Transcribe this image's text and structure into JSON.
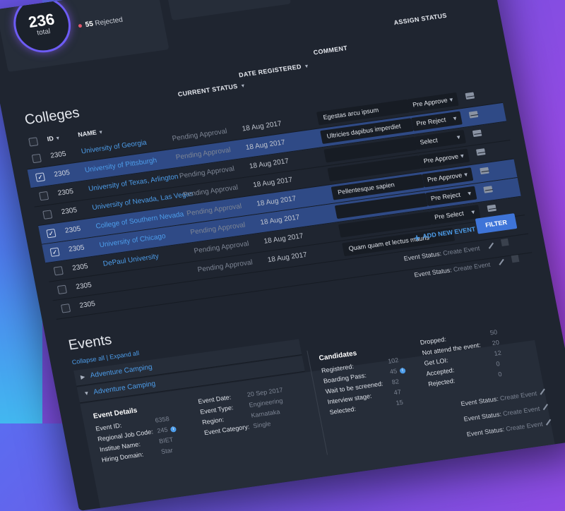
{
  "summary": {
    "total_number": "236",
    "total_label": "total",
    "rejected_count": "55",
    "rejected_label": "Rejected"
  },
  "colleges": {
    "title": "Colleges",
    "headers": {
      "id": "ID",
      "name": "NAME",
      "current_status": "CURRENT STATUS",
      "date_registered": "DATE REGISTERED",
      "comment": "COMMENT",
      "assign_status": "ASSIGN STATUS"
    },
    "rows": [
      {
        "id": "2305",
        "name": "University of Georgia",
        "status": "Pending Approval",
        "date": "18 Aug 2017",
        "comment": "Egestas arcu ipsum",
        "assign": "Pre Approve",
        "selected": false
      },
      {
        "id": "2305",
        "name": "University of Pittsburgh",
        "status": "Pending Approval",
        "date": "18 Aug 2017",
        "comment": "Ultricies dapibus imperdiet",
        "assign": "Pre Reject",
        "selected": true
      },
      {
        "id": "2305",
        "name": "University of Texas, Arlington",
        "status": "Pending Approval",
        "date": "18 Aug 2017",
        "comment": "",
        "assign": "Select",
        "selected": false
      },
      {
        "id": "2305",
        "name": "University of Nevada, Las Vegas",
        "status": "Pending Approval",
        "date": "18 Aug 2017",
        "comment": "",
        "assign": "Pre Approve",
        "selected": false
      },
      {
        "id": "2305",
        "name": "College of Southern Nevada",
        "status": "Pending Approval",
        "date": "18 Aug 2017",
        "comment": "Pellentesque sapien",
        "assign": "Pre Approve",
        "selected": true
      },
      {
        "id": "2305",
        "name": "University of Chicago",
        "status": "Pending Approval",
        "date": "18 Aug 2017",
        "comment": "",
        "assign": "Pre Reject",
        "selected": true
      },
      {
        "id": "2305",
        "name": "DePaul University",
        "status": "Pending Approval",
        "date": "18 Aug 2017",
        "comment": "",
        "assign": "Pre Select",
        "selected": false
      },
      {
        "id": "2305",
        "name": "",
        "status": "Pending Approval",
        "date": "18 Aug 2017",
        "comment": "Quam quam et lectus mauris",
        "assign": "",
        "selected": false
      },
      {
        "id": "2305",
        "name": "",
        "status": "",
        "date": "",
        "comment": "",
        "assign": "",
        "selected": false
      }
    ],
    "add_event_label": "ADD NEW EVENT",
    "filter_label": "FILTER"
  },
  "event_status": {
    "label": "Event Status:",
    "value": "Create Event"
  },
  "events": {
    "title": "Events",
    "collapse_all": "Collapse all",
    "separator": "|",
    "expand_all": "Expand all",
    "items": [
      {
        "name": "Adventure Camping",
        "expanded": false
      },
      {
        "name": "Adventure Camping",
        "expanded": true
      }
    ],
    "details": {
      "title": "Event Details",
      "event_id_label": "Event ID:",
      "event_id": "6358",
      "job_code_label": "Regional Job Code:",
      "job_code": "245",
      "institute_label": "Institue Name:",
      "institute": "BIET",
      "hiring_domain_label": "Hiring Domain:",
      "hiring_domain": "Star",
      "event_date_label": "Event Date:",
      "event_date": "20 Sep 2017",
      "event_type_label": "Event Type:",
      "event_type": "Engineering",
      "region_label": "Region:",
      "region": "Karnataka",
      "category_label": "Event Category:",
      "category": "Single"
    },
    "candidates": {
      "title": "Candidates",
      "registered_label": "Registered:",
      "registered": "102",
      "boarding_label": "Boarding Pass:",
      "boarding": "45",
      "wait_label": "Wait to be screened:",
      "wait": "82",
      "interview_label": "Interview stage:",
      "interview": "47",
      "selected_label": "Selected:",
      "selected": "15",
      "dropped_label": "Dropped:",
      "dropped": "50",
      "not_attend_label": "Not attend the event:",
      "not_attend": "20",
      "loi_label": "Get LOI:",
      "loi": "12",
      "accepted_label": "Accepted:",
      "accepted": "0",
      "rejected_label": "Rejected:",
      "rejected": "0"
    }
  }
}
